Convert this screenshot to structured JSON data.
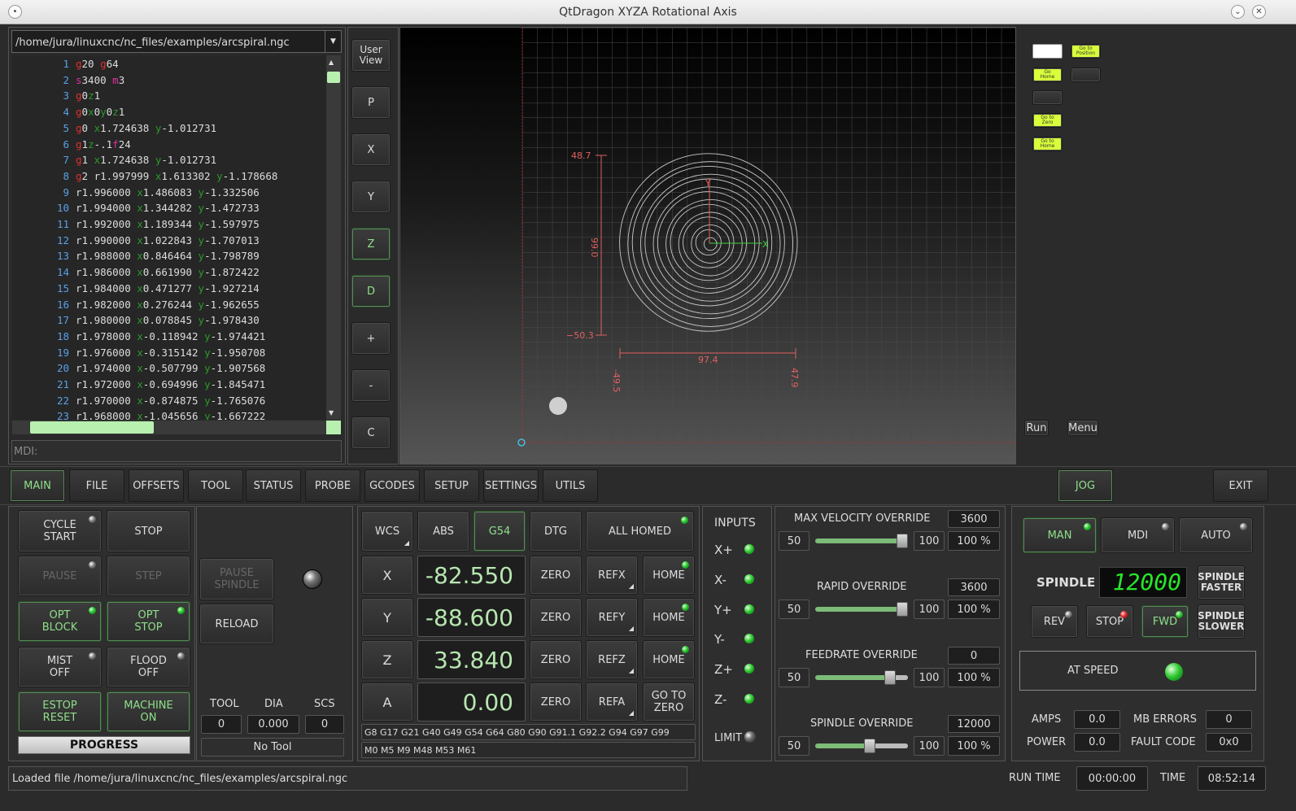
{
  "window": {
    "title": "QtDragon XYZA Rotational Axis"
  },
  "file": {
    "path": "/home/jura/linuxcnc/nc_files/examples/arcspiral.ngc"
  },
  "code_lines": [
    {
      "n": "1",
      "t": "g20 g64"
    },
    {
      "n": "2",
      "t": "s3400 m3"
    },
    {
      "n": "3",
      "t": "g0z1"
    },
    {
      "n": "4",
      "t": "g0x0y0z1"
    },
    {
      "n": "5",
      "t": "g0 x1.724638 y-1.012731"
    },
    {
      "n": "6",
      "t": "g1z-.1f24"
    },
    {
      "n": "7",
      "t": "g1 x1.724638 y-1.012731"
    },
    {
      "n": "8",
      "t": "g2 r1.997999 x1.613302 y-1.178668"
    },
    {
      "n": "9",
      "t": "r1.996000 x1.486083 y-1.332506"
    },
    {
      "n": "10",
      "t": "r1.994000 x1.344282 y-1.472733"
    },
    {
      "n": "11",
      "t": "r1.992000 x1.189344 y-1.597975"
    },
    {
      "n": "12",
      "t": "r1.990000 x1.022843 y-1.707013"
    },
    {
      "n": "13",
      "t": "r1.988000 x0.846464 y-1.798789"
    },
    {
      "n": "14",
      "t": "r1.986000 x0.661990 y-1.872422"
    },
    {
      "n": "15",
      "t": "r1.984000 x0.471277 y-1.927214"
    },
    {
      "n": "16",
      "t": "r1.982000 x0.276244 y-1.962655"
    },
    {
      "n": "17",
      "t": "r1.980000 x0.078845 y-1.978430"
    },
    {
      "n": "18",
      "t": "r1.978000 x-0.118942 y-1.974421"
    },
    {
      "n": "19",
      "t": "r1.976000 x-0.315142 y-1.950708"
    },
    {
      "n": "20",
      "t": "r1.974000 x-0.507799 y-1.907568"
    },
    {
      "n": "21",
      "t": "r1.972000 x-0.694996 y-1.845471"
    },
    {
      "n": "22",
      "t": "r1.970000 x-0.874875 y-1.765076"
    },
    {
      "n": "23",
      "t": "r1.968000 x-1.045656 y-1.667222"
    }
  ],
  "mdi": {
    "placeholder": "MDI:"
  },
  "view_buttons": {
    "user_view": "User\nView",
    "p": "P",
    "x": "X",
    "y": "Y",
    "z": "Z",
    "d": "D",
    "plus": "+",
    "minus": "-",
    "c": "C"
  },
  "preview": {
    "dim_top": "48.7",
    "dim_bottom": "−50.3",
    "dim_height": "99.0",
    "dim_width": "97.4",
    "dim_left": "-49.5",
    "dim_right": "47.9"
  },
  "macro": {
    "go_to_position": "Go to\nPosition",
    "go_home": "Go\nHome",
    "go_to_zero": "Go to\nZero",
    "go_to_home": "Go to\nHome",
    "run": "Run",
    "menu": "Menu"
  },
  "tabs": [
    "MAIN",
    "FILE",
    "OFFSETS",
    "TOOL",
    "STATUS",
    "PROBE",
    "GCODES",
    "SETUP",
    "SETTINGS",
    "UTILS"
  ],
  "jog": "JOG",
  "exit": "EXIT",
  "controls": {
    "cycle_start": "CYCLE\nSTART",
    "stop": "STOP",
    "pause": "PAUSE",
    "step": "STEP",
    "opt_block": "OPT\nBLOCK",
    "opt_stop": "OPT\nSTOP",
    "mist_off": "MIST\nOFF",
    "flood_off": "FLOOD\nOFF",
    "estop_reset": "ESTOP\nRESET",
    "machine_on": "MACHINE\nON",
    "progress": "PROGRESS"
  },
  "mid": {
    "pause_spindle": "PAUSE\nSPINDLE",
    "reload": "RELOAD",
    "tool_label": "TOOL",
    "dia_label": "DIA",
    "scs_label": "SCS",
    "tool": "0",
    "dia": "0.000",
    "scs": "0",
    "no_tool": "No Tool"
  },
  "dro": {
    "wcs": "WCS",
    "abs": "ABS",
    "g54": "G54",
    "dtg": "DTG",
    "all_homed": "ALL HOMED",
    "axes": [
      {
        "name": "X",
        "value": "-82.550",
        "ref": "REFX",
        "home": "HOME"
      },
      {
        "name": "Y",
        "value": "-88.600",
        "ref": "REFY",
        "home": "HOME"
      },
      {
        "name": "Z",
        "value": "33.840",
        "ref": "REFZ",
        "home": "HOME"
      },
      {
        "name": "A",
        "value": "0.00",
        "ref": "REFA",
        "home": "GO TO\nZERO"
      }
    ],
    "zero": "ZERO",
    "gcodes": "G8 G17 G21 G40 G49 G54 G64 G80 G90 G91.1 G92.2 G94 G97 G99",
    "mcodes": "M0 M5 M9 M48 M53 M61"
  },
  "inputs": {
    "title": "INPUTS",
    "items": [
      "X+",
      "X-",
      "Y+",
      "Y-",
      "Z+",
      "Z-"
    ],
    "limit": "LIMIT"
  },
  "overrides": [
    {
      "name": "MAX VELOCITY OVERRIDE",
      "value": "3600",
      "min": "50",
      "max": "100",
      "pct": "100 %",
      "level": 1.0
    },
    {
      "name": "RAPID OVERRIDE",
      "value": "3600",
      "min": "50",
      "max": "100",
      "pct": "100 %",
      "level": 1.0
    },
    {
      "name": "FEEDRATE OVERRIDE",
      "value": "0",
      "min": "50",
      "max": "100",
      "pct": "100 %",
      "level": 0.85
    },
    {
      "name": "SPINDLE OVERRIDE",
      "value": "12000",
      "min": "50",
      "max": "100",
      "pct": "100 %",
      "level": 0.6
    }
  ],
  "spindle": {
    "man": "MAN",
    "mdi": "MDI",
    "auto": "AUTO",
    "label": "SPINDLE",
    "rpm": "12000",
    "faster": "SPINDLE\nFASTER",
    "slower": "SPINDLE\nSLOWER",
    "rev": "REV",
    "stop": "STOP",
    "fwd": "FWD",
    "at_speed": "AT SPEED",
    "amps_label": "AMPS",
    "amps": "0.0",
    "power_label": "POWER",
    "power": "0.0",
    "mb_errors_label": "MB ERRORS",
    "mb_errors": "0",
    "fault_label": "FAULT CODE",
    "fault": "0x0"
  },
  "status": {
    "message": "Loaded file /home/jura/linuxcnc/nc_files/examples/arcspiral.ngc",
    "run_time_label": "RUN TIME",
    "run_time": "00:00:00",
    "time_label": "TIME",
    "time": "08:52:14"
  },
  "colors": {
    "accent_green": "#8fe08a",
    "led_green": "#33cc33",
    "dro_green": "#b7e6b0",
    "macro_yellow": "#d8ff3a",
    "preview_red": "#e06060"
  }
}
